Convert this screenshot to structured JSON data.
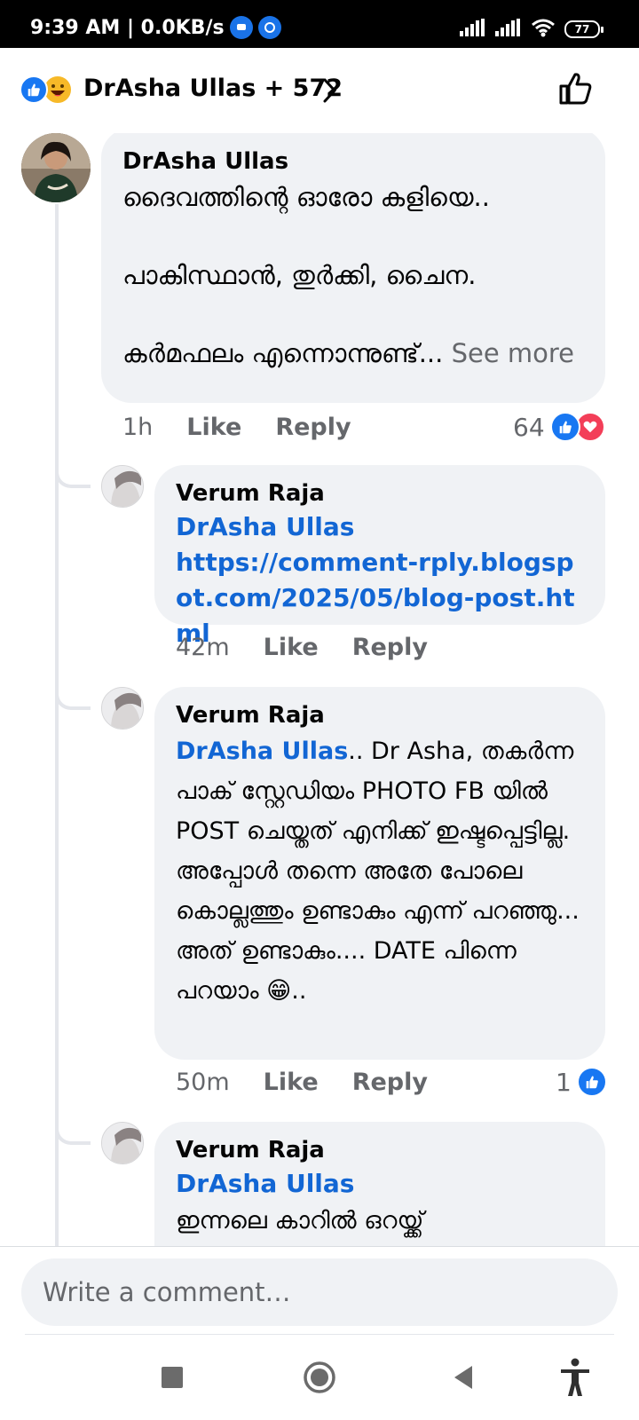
{
  "status_bar": {
    "time_speed": "9:39 AM | 0.0KB/s",
    "battery": "77"
  },
  "header": {
    "reaction_summary": "DrAsha Ullas + 572"
  },
  "comments": [
    {
      "author": "DrAsha Ullas",
      "text": "ദൈവത്തിന്റെ ഓരോ കളിയെ..\n\nപാകിസ്ഥാൻ, തുർക്കി, ചൈന.\n\nകർമഫലം എന്നൊന്നുണ്ട്... ",
      "see_more": "See more",
      "time": "1h",
      "like": "Like",
      "reply": "Reply",
      "reaction_count": "64"
    }
  ],
  "replies": [
    {
      "author": "Verum Raja",
      "mention": "DrAsha Ullas",
      "link": "https://comment-rply.blogspot.com/2025/05/blog-post.html",
      "time": "42m",
      "like": "Like",
      "reply": "Reply"
    },
    {
      "author": "Verum Raja",
      "mention": "DrAsha Ullas",
      "text": ".. Dr Asha, തകർന്ന പാക് സ്റ്റേഡിയം PHOTO FB യിൽ POST ചെയ്തത് എനിക്ക് ഇഷ്ടപ്പെട്ടില്ല. അപ്പോൾ തന്നെ അതേ പോലെ കൊല്ലത്തും ഉണ്ടാകും എന്ന് പറഞ്ഞു... അത് ഉണ്ടാകും.... DATE പിന്നെ പറയാം 😁..",
      "time": "50m",
      "like": "Like",
      "reply": "Reply",
      "reaction_count": "1"
    },
    {
      "author": "Verum Raja",
      "mention": "DrAsha Ullas",
      "text": "ഇന്നലെ കാറിൽ ഒറയ്ക്ക്"
    }
  ],
  "composer": {
    "placeholder": "Write a comment…"
  },
  "colors": {
    "accent": "#1877f2",
    "mention": "#1266d4",
    "bubble": "#f0f2f5",
    "secondary_text": "#65676b",
    "love": "#f33e58"
  }
}
